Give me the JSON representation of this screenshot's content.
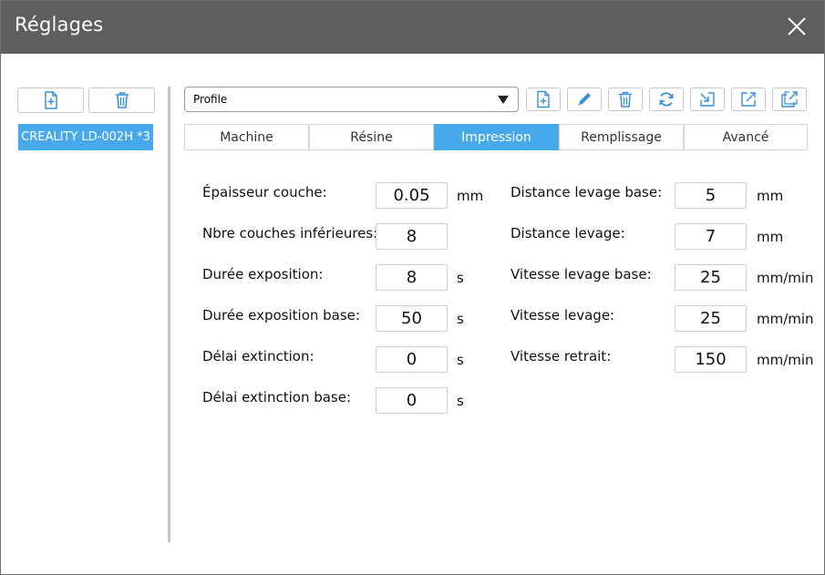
{
  "window": {
    "title": "Réglages"
  },
  "left": {
    "presets": [
      "CREALITY LD-002H *3"
    ]
  },
  "toolbar": {
    "profile_value": "Profile"
  },
  "tabs": [
    "Machine",
    "Résine",
    "Impression",
    "Remplissage",
    "Avancé"
  ],
  "active_tab": "Impression",
  "form": {
    "left": [
      {
        "label": "Épaisseur couche:",
        "value": "0.05",
        "unit": "mm"
      },
      {
        "label": "Nbre couches inférieures:",
        "value": "8",
        "unit": ""
      },
      {
        "label": "Durée exposition:",
        "value": "8",
        "unit": "s"
      },
      {
        "label": "Durée exposition base:",
        "value": "50",
        "unit": "s"
      },
      {
        "label": "Délai extinction:",
        "value": "0",
        "unit": "s"
      },
      {
        "label": "Délai extinction base:",
        "value": "0",
        "unit": "s"
      }
    ],
    "right": [
      {
        "label": "Distance levage base:",
        "value": "5",
        "unit": "mm"
      },
      {
        "label": "Distance levage:",
        "value": "7",
        "unit": "mm"
      },
      {
        "label": "Vitesse levage base:",
        "value": "25",
        "unit": "mm/min"
      },
      {
        "label": "Vitesse levage:",
        "value": "25",
        "unit": "mm/min"
      },
      {
        "label": "Vitesse retrait:",
        "value": "150",
        "unit": "mm/min"
      }
    ]
  },
  "colors": {
    "accent": "#47a9ea",
    "titlebar": "#5f5f5f"
  }
}
